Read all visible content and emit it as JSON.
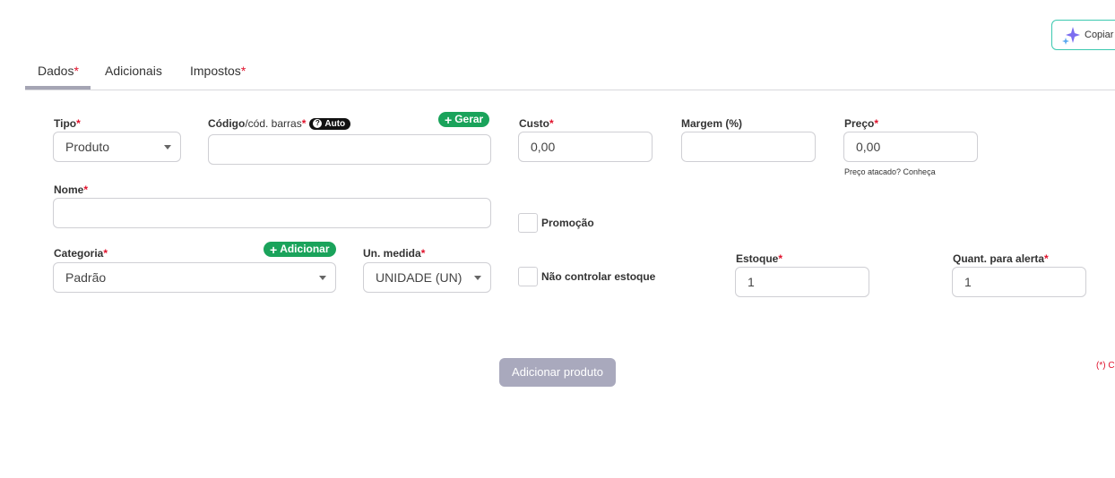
{
  "copy_button": {
    "label": "Copiar"
  },
  "tabs": [
    {
      "label": "Dados",
      "required": "*"
    },
    {
      "label": "Adicionais"
    },
    {
      "label": "Impostos",
      "required": "*"
    }
  ],
  "form": {
    "tipo": {
      "label": "Tipo",
      "required": "*",
      "value": "Produto"
    },
    "codigo": {
      "label_bold": "Código",
      "label_normal": "/cód. barras",
      "required": "*",
      "auto_badge": "Auto",
      "generate_button": "Gerar",
      "value": ""
    },
    "custo": {
      "label": "Custo",
      "required": "*",
      "value": "0,00"
    },
    "margem": {
      "label": "Margem (%)",
      "value": ""
    },
    "preco": {
      "label": "Preço",
      "required": "*",
      "value": "0,00",
      "hint": "Preço atacado? Conheça"
    },
    "nome": {
      "label": "Nome",
      "required": "*",
      "value": ""
    },
    "promocao": {
      "label": "Promoção",
      "checked": false
    },
    "categoria": {
      "label": "Categoria",
      "required": "*",
      "value": "Padrão",
      "add_button": "Adicionar"
    },
    "unidade": {
      "label": "Un. medida",
      "required": "*",
      "value": "UNIDADE (UN)"
    },
    "nao_controlar": {
      "label": "Não controlar estoque",
      "checked": false
    },
    "estoque": {
      "label": "Estoque",
      "required": "*",
      "value": "1"
    },
    "alerta": {
      "label": "Quant. para alerta",
      "required": "*",
      "value": "1"
    }
  },
  "submit_button": {
    "label": "Adicionar produto",
    "enabled": false
  },
  "footnote": "(*) C",
  "colors": {
    "accent_green": "#1aa35b",
    "required_red": "#e0112b",
    "tab_underline": "#a5a5b4",
    "disabled_button": "#a9a9bd"
  }
}
